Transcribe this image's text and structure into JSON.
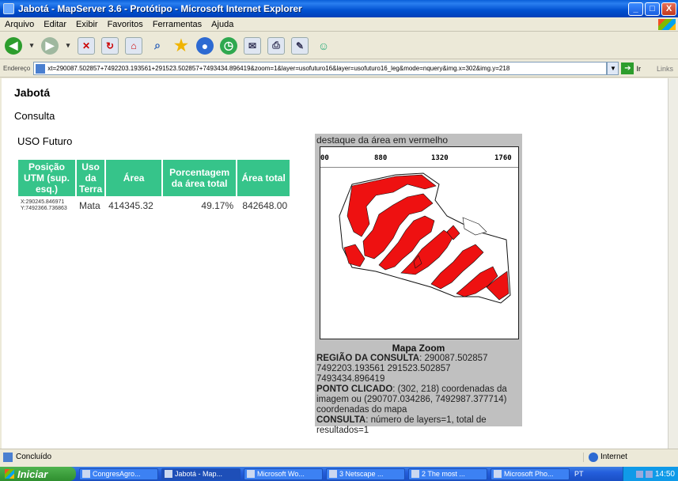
{
  "window": {
    "title": "Jabotá - MapServer 3.6 - Protótipo - Microsoft Internet Explorer",
    "minimize": "_",
    "maximize": "□",
    "close": "X"
  },
  "menu": [
    "Arquivo",
    "Editar",
    "Exibir",
    "Favoritos",
    "Ferramentas",
    "Ajuda"
  ],
  "address": {
    "label": "Endereço",
    "url": "xt=290087.502857+7492203.193561+291523.502857+7493434.896419&zoom=1&layer=usofuturo16&layer=usofuturo16_leg&mode=nquery&img.x=302&img.y=218",
    "go_label": "Ir",
    "links_label": "Links"
  },
  "page": {
    "site_title": "Jabotá",
    "section_title": "Consulta",
    "sub_title": "USO Futuro"
  },
  "table": {
    "headers": [
      "Posição UTM (sup. esq.)",
      "Uso da Terra",
      "Área",
      "Porcentagem da área total",
      "Área total"
    ],
    "row": {
      "coord_x": "X:290245.846971",
      "coord_y": "Y:7492366.736863",
      "uso": "Mata",
      "area": "414345.32",
      "percent": "49.17%",
      "area_total": "842648.00"
    }
  },
  "map": {
    "header": "destaque da área em vermelho",
    "ruler_ticks": [
      "00",
      "880",
      "1320",
      "1760"
    ],
    "zoom_label": "Mapa Zoom",
    "highlight_color": "#ee1111",
    "info": {
      "regiao_label": "REGIÃO DA CONSULTA",
      "regiao_value": ": 290087.502857 7492203.193561 291523.502857 7493434.896419",
      "ponto_label": "PONTO CLICADO",
      "ponto_value": ": (302, 218) coordenadas da imagem ou (290707.034286, 7492987.377714) coordenadas do mapa",
      "consulta_label": "CONSULTA",
      "consulta_value": ": número de layers=1, total de resultados=1"
    }
  },
  "status": {
    "text": "Concluído",
    "zone": "Internet"
  },
  "taskbar": {
    "start": "Iniciar",
    "tasks": [
      "CongresAgro...",
      "Jabotá - Map...",
      "Microsoft Wo...",
      "3 Netscape ...",
      "2 The most ...",
      "Microsoft Pho..."
    ],
    "lang": "PT",
    "clock": "14:50"
  }
}
